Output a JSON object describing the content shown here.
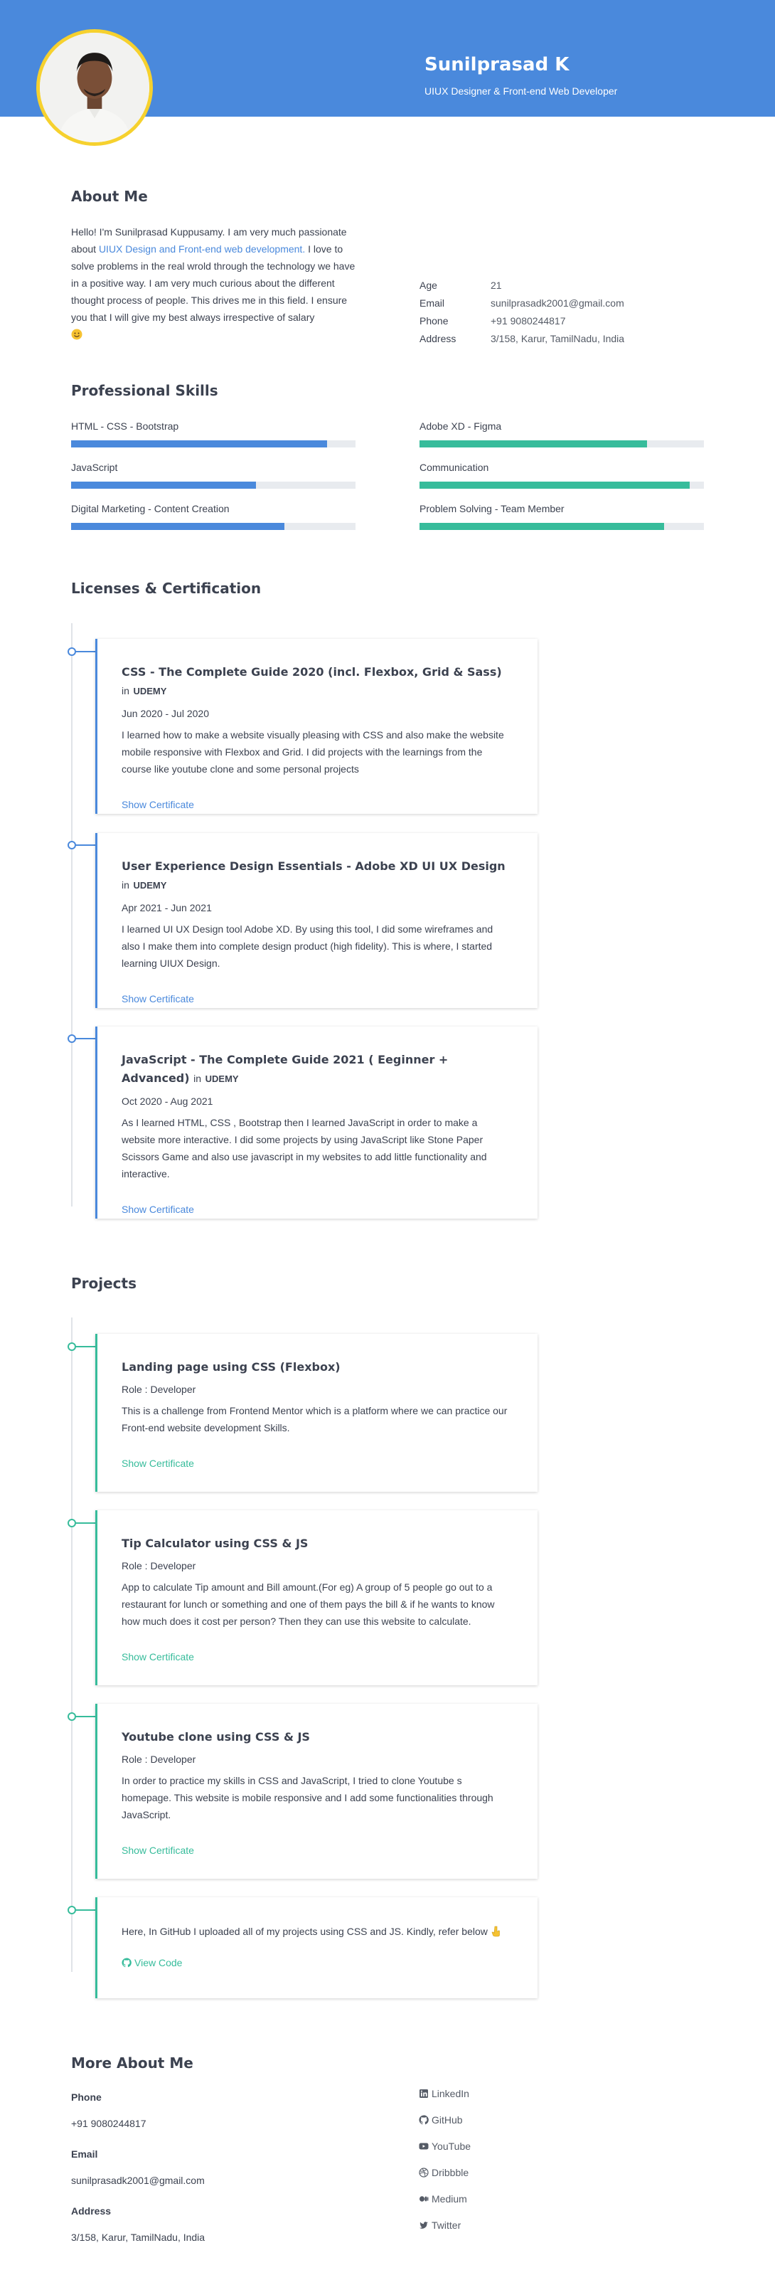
{
  "header": {
    "name": "Sunilprasad K",
    "role": "UIUX Designer & Front-end Web Developer",
    "accent_color": "#4a89dc",
    "avatar_ring_color": "#f6d12e"
  },
  "about": {
    "heading": "About Me",
    "text_part1": "Hello! I'm Sunilprasad Kuppusamy. I am very much passionate about ",
    "text_highlight": "UIUX Design and Front-end web development.",
    "text_part2": " I love to solve problems in the real wrold through the technology we have in a positive way. I am very much curious about the different thought process of people. This drives me in this field. I ensure you that I will give my best always irrespective of salary",
    "emoji_icon": "smiling-face-emoji",
    "info": [
      {
        "key": "Age",
        "value": "21"
      },
      {
        "key": "Email",
        "value": "sunilprasadk2001@gmail.com"
      },
      {
        "key": "Phone",
        "value": "+91 9080244817"
      },
      {
        "key": "Address",
        "value": "3/158, Karur, TamilNadu, India"
      }
    ]
  },
  "skills": {
    "heading": "Professional Skills",
    "left_color": "#4a89dc",
    "right_color": "#37bc9b",
    "left": [
      {
        "name": "HTML - CSS - Bootstrap",
        "level": 0.9
      },
      {
        "name": "JavaScript",
        "level": 0.65
      },
      {
        "name": "Digital Marketing - Content Creation",
        "level": 0.75
      }
    ],
    "right": [
      {
        "name": "Adobe XD - Figma",
        "level": 0.8
      },
      {
        "name": "Communication",
        "level": 0.95
      },
      {
        "name": "Problem Solving - Team Member",
        "level": 0.86
      }
    ]
  },
  "licenses": {
    "heading": "Licenses & Certification",
    "items": [
      {
        "title": "CSS - The Complete Guide 2020 (incl. Flexbox, Grid & Sass)",
        "in": "in",
        "org": "UDEMY",
        "date": "Jun 2020 - Jul 2020",
        "desc": "I learned how to make a website visually pleasing with CSS and also make the website mobile responsive with Flexbox and Grid. I did projects with the learnings from the course like youtube clone and some personal projects",
        "link": "Show Certificate"
      },
      {
        "title": "User Experience Design Essentials - Adobe XD UI UX Design",
        "in": "in",
        "org": "UDEMY",
        "date": "Apr 2021 - Jun 2021",
        "desc": "I learned UI UX Design tool Adobe XD. By using this tool, I did some wireframes and also I make them into complete design product (high fidelity). This is where, I started learning UIUX Design.",
        "link": "Show Certificate"
      },
      {
        "title": "JavaScript - The Complete Guide 2021 ( Eeginner + Advanced)",
        "in": "in",
        "org": "UDEMY",
        "date": "Oct 2020 - Aug 2021",
        "desc": "As I learned HTML, CSS , Bootstrap then I learned JavaScript in order to make a website more interactive. I did some projects by using JavaScript like Stone Paper Scissors Game and also use javascript in my websites to add little functionality and interactive.",
        "link": "Show Certificate"
      }
    ]
  },
  "projects": {
    "heading": "Projects",
    "accent_color": "#37bc9b",
    "items": [
      {
        "title": "Landing page using CSS (Flexbox)",
        "role": "Role : Developer",
        "desc": "This is a challenge from Frontend Mentor which is a platform where we can practice our Front-end website development Skills.",
        "link": "Show Certificate"
      },
      {
        "title": "Tip Calculator using CSS & JS",
        "role": "Role : Developer",
        "desc": "App to calculate Tip amount and Bill amount.(For eg) A group of 5 people go out to a restaurant for lunch or something and one of them pays the bill & if he wants to know how much does it cost per person? Then they can use this website to calculate.",
        "link": "Show Certificate"
      },
      {
        "title": "Youtube clone using CSS & JS",
        "role": "Role : Developer",
        "desc": "In order to practice my skills in CSS and JavaScript, I tried to clone Youtube s homepage. This website is mobile responsive and I add some functionalities through JavaScript.",
        "link": "Show Certificate"
      }
    ],
    "github": {
      "text": "Here, In GitHub I uploaded all of my projects using CSS and JS. Kindly, refer below",
      "pointer_icon": "pointing-down-hand-emoji",
      "link": "View Code",
      "link_icon": "github-icon"
    }
  },
  "more": {
    "heading": "More About Me",
    "fields": [
      {
        "label": "Phone",
        "value": "+91 9080244817"
      },
      {
        "label": "Email",
        "value": "sunilprasadk2001@gmail.com"
      },
      {
        "label": "Address",
        "value": "3/158, Karur, TamilNadu, India"
      }
    ],
    "social": [
      {
        "label": "LinkedIn",
        "icon": "linkedin-icon"
      },
      {
        "label": "GitHub",
        "icon": "github-icon"
      },
      {
        "label": "YouTube",
        "icon": "youtube-icon"
      },
      {
        "label": "Dribbble",
        "icon": "dribbble-icon"
      },
      {
        "label": "Medium",
        "icon": "medium-icon"
      },
      {
        "label": "Twitter",
        "icon": "twitter-icon"
      }
    ]
  }
}
